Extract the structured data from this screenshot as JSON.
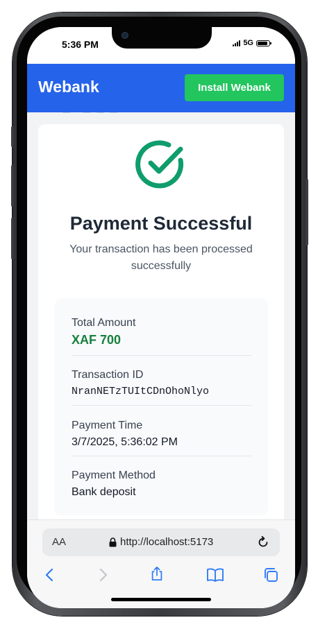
{
  "status_bar": {
    "time": "5:36 PM",
    "network": "5G"
  },
  "app": {
    "brand": "Webank",
    "install_button": "Install Webank",
    "brand_color": "#2563eb",
    "install_color": "#22c55e"
  },
  "payment": {
    "icon": "check-circle-icon",
    "title": "Payment Successful",
    "subtitle": "Your transaction has been processed successfully",
    "details": [
      {
        "label": "Total Amount",
        "value": "XAF 700"
      },
      {
        "label": "Transaction ID",
        "value": "NranNETzTUItCDnOhoNlyo"
      },
      {
        "label": "Payment Time",
        "value": "3/7/2025, 5:36:02 PM"
      },
      {
        "label": "Payment Method",
        "value": "Bank deposit"
      }
    ],
    "success_color": "#0f9d6b"
  },
  "browser": {
    "text_size_label": "AA",
    "url": "http://localhost:5173",
    "icons": [
      "back-icon",
      "forward-icon",
      "share-icon",
      "bookmarks-icon",
      "tabs-icon"
    ]
  }
}
